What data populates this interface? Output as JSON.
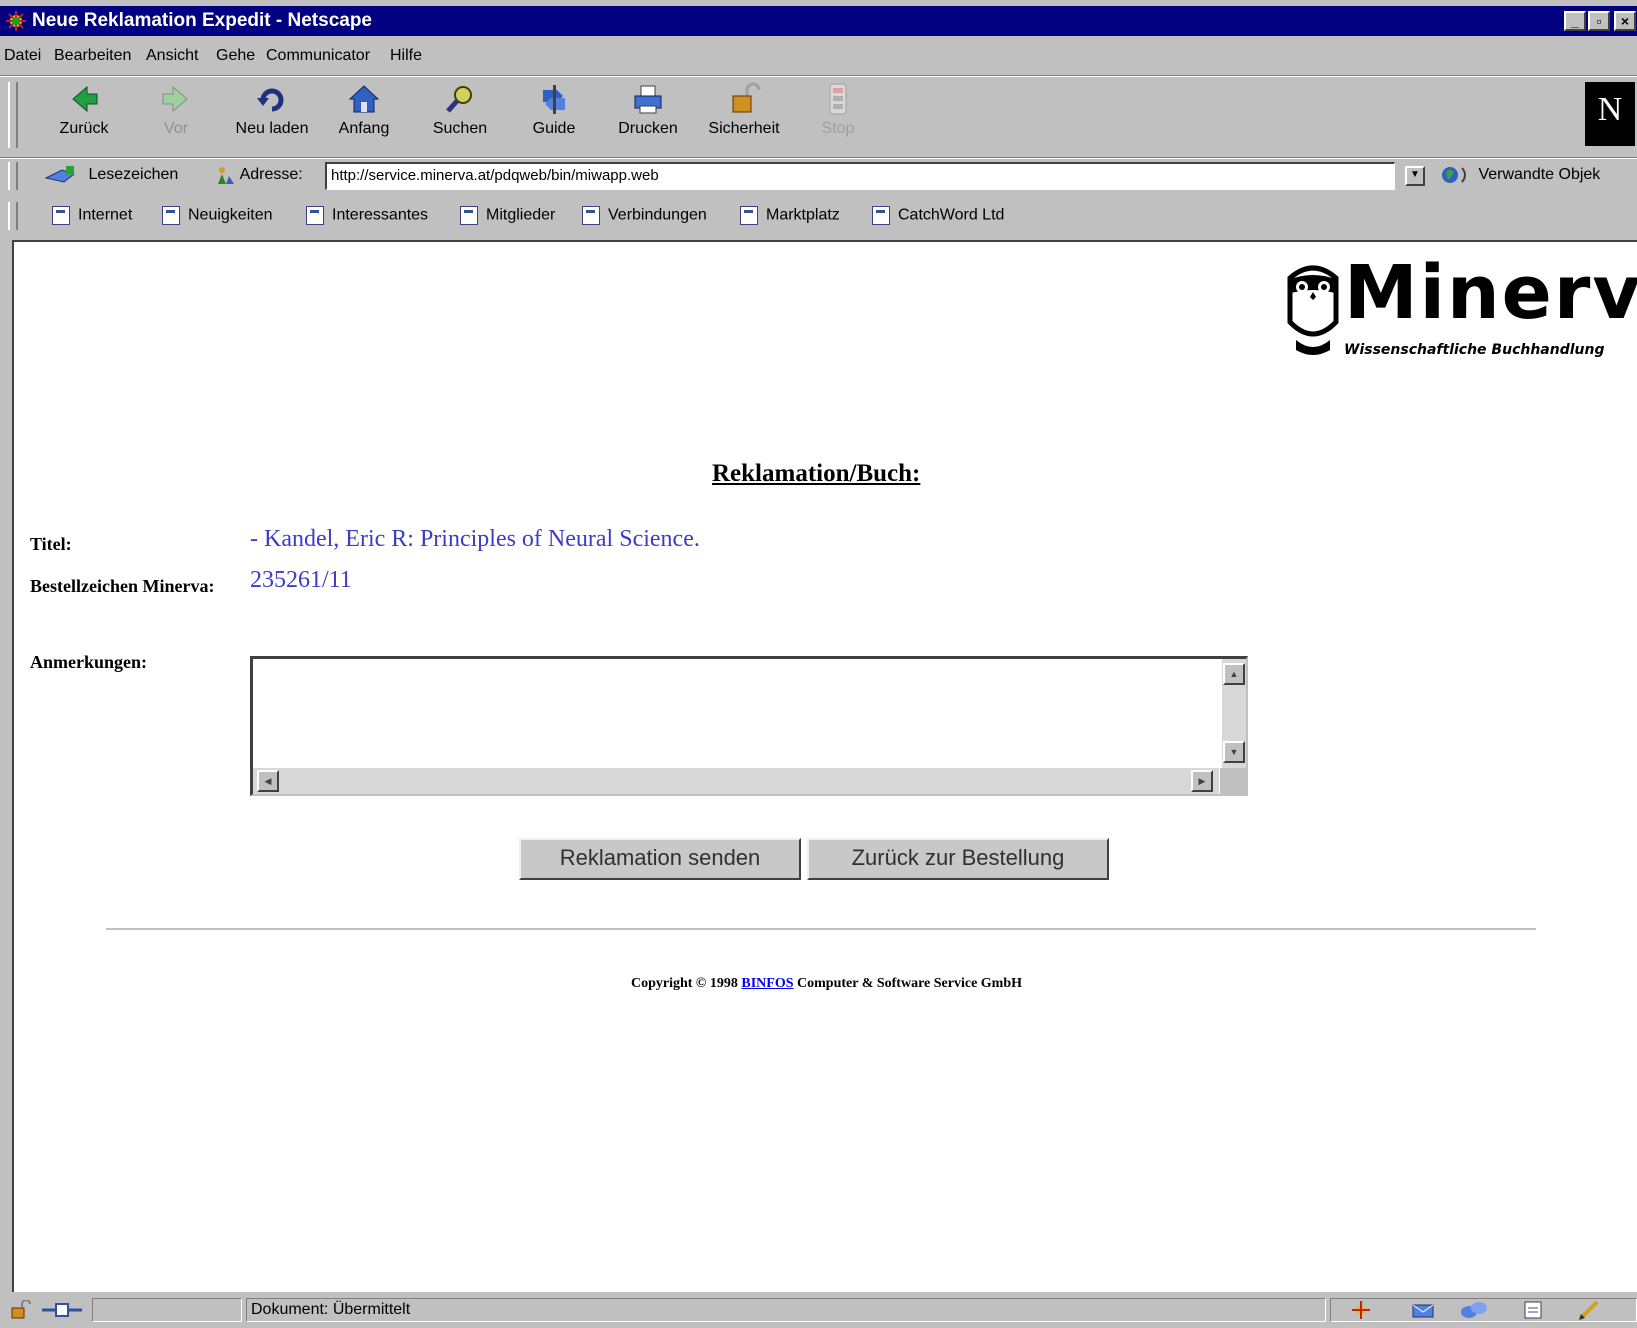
{
  "window": {
    "title": "Neue Reklamation Expedit - Netscape",
    "controls": [
      "_",
      "▫",
      "×"
    ]
  },
  "menu": [
    "Datei",
    "Bearbeiten",
    "Ansicht",
    "Gehe",
    "Communicator",
    "Hilfe"
  ],
  "toolbar": {
    "back": "Zurück",
    "forward": "Vor",
    "reload": "Neu laden",
    "home": "Anfang",
    "search": "Suchen",
    "guide": "Guide",
    "print": "Drucken",
    "security": "Sicherheit",
    "stop": "Stop"
  },
  "location": {
    "bookmarks": "Lesezeichen",
    "address_label": "Adresse:",
    "url": "http://service.minerva.at/pdqweb/bin/miwapp.web",
    "related": "Verwandte Objek"
  },
  "personal_toolbar": [
    "Internet",
    "Neuigkeiten",
    "Interessantes",
    "Mitglieder",
    "Verbindungen",
    "Marktplatz",
    "CatchWord Ltd"
  ],
  "page": {
    "logo_word": "Minerva",
    "logo_sub": "Wissenschaftliche Buchhandlung",
    "heading": "Reklamation/Buch:",
    "title_label": "Titel:",
    "title_value": "- Kandel, Eric R: Principles of Neural Science.",
    "order_label": "Bestellzeichen Minerva:",
    "order_value": "235261/11",
    "notes_label": "Anmerkungen:",
    "notes_value": "",
    "submit_button": "Reklamation senden",
    "back_button": "Zurück zur Bestellung",
    "copyright_prefix": "Copyright © 1998",
    "copyright_link": "BINFOS",
    "copyright_suffix": "Computer & Software Service GmbH"
  },
  "status": {
    "text": "Dokument: Übermittelt"
  },
  "colors": {
    "titlebar": "#000080",
    "link_blue": "#3c3cc8",
    "chrome": "#c0c0c0"
  }
}
